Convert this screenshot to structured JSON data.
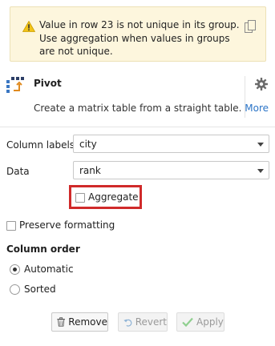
{
  "warning": {
    "message": "Value in row 23 is not unique in its group. Use aggregation when values in groups are not unique.",
    "icon": "warning-triangle-icon",
    "copy_icon": "copy-icon"
  },
  "widget": {
    "title": "Pivot",
    "description": "Create a matrix table from a straight table.",
    "more_link": "More"
  },
  "fields": {
    "column_labels": {
      "label": "Column labels",
      "value": "city"
    },
    "data": {
      "label": "Data",
      "value": "rank"
    }
  },
  "options": {
    "aggregate": {
      "label": "Aggregate",
      "checked": false
    },
    "preserve_formatting": {
      "label": "Preserve formatting",
      "checked": false
    }
  },
  "column_order": {
    "title": "Column order",
    "options": [
      {
        "label": "Automatic",
        "selected": true
      },
      {
        "label": "Sorted",
        "selected": false
      }
    ]
  },
  "buttons": {
    "remove": "Remove",
    "revert": "Revert",
    "apply": "Apply"
  },
  "colors": {
    "highlight": "#d02a2a",
    "warning_bg": "#fdf6dd",
    "link": "#2b74c7"
  }
}
